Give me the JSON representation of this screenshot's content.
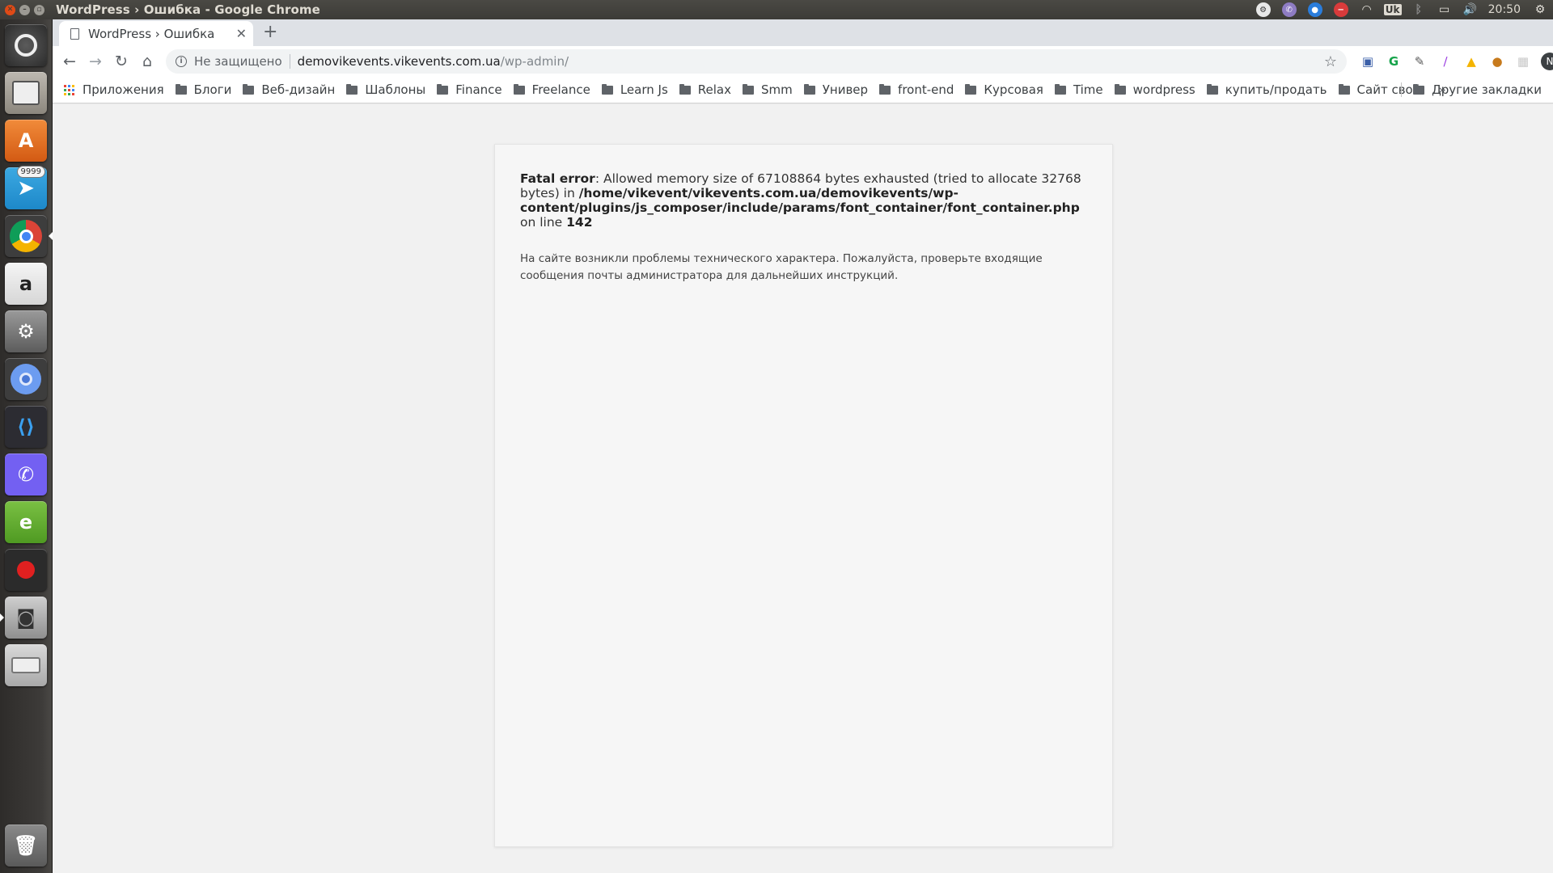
{
  "window": {
    "title": "WordPress › Ошибка - Google Chrome",
    "clock": "20:50",
    "keyboard_layout": "Uk"
  },
  "tabs": [
    {
      "title": "WordPress › Ошибка",
      "active": true
    }
  ],
  "omnibox": {
    "security_label": "Не защищено",
    "url_host": "demovikevents.vikevents.com.ua",
    "url_path": "/wp-admin/"
  },
  "profile": {
    "initial": "N"
  },
  "bookmarks": {
    "apps_label": "Приложения",
    "folders": [
      "Блоги",
      "Веб-дизайн",
      "Шаблоны",
      "Finance",
      "Freelance",
      "Learn Js",
      "Relax",
      "Smm",
      "Универ",
      "front-end",
      "Курсовая",
      "Time",
      "wordpress",
      "купить/продать",
      "Сайт свой"
    ],
    "more": "»",
    "other_label": "Другие закладки"
  },
  "launcher": {
    "telegram_badge": "9999",
    "apps": [
      "ubuntu-dash",
      "files",
      "software-center",
      "telegram",
      "chrome",
      "amazon",
      "system-settings",
      "chromium",
      "vscode",
      "viber",
      "evernote",
      "screen-recorder",
      "camera",
      "disk-drive",
      "trash"
    ]
  },
  "page": {
    "error_label": "Fatal error",
    "error_text": ": Allowed memory size of 67108864 bytes exhausted (tried to allocate 32768 bytes) in ",
    "error_path": "/home/vikevent/vikevents.com.ua/demovikevents/wp-content/plugins/js_composer/include/params/font_container/font_container.php",
    "error_on_line": " on line ",
    "error_line": "142",
    "message": "На сайте возникли проблемы технического характера. Пожалуйста, проверьте входящие сообщения почты администратора для дальнейших инструкций."
  },
  "colors": {
    "panel": "#3c3b37",
    "tab_strip": "#dee1e6",
    "page_bg": "#f1f1f1",
    "close_button": "#df4a16"
  }
}
